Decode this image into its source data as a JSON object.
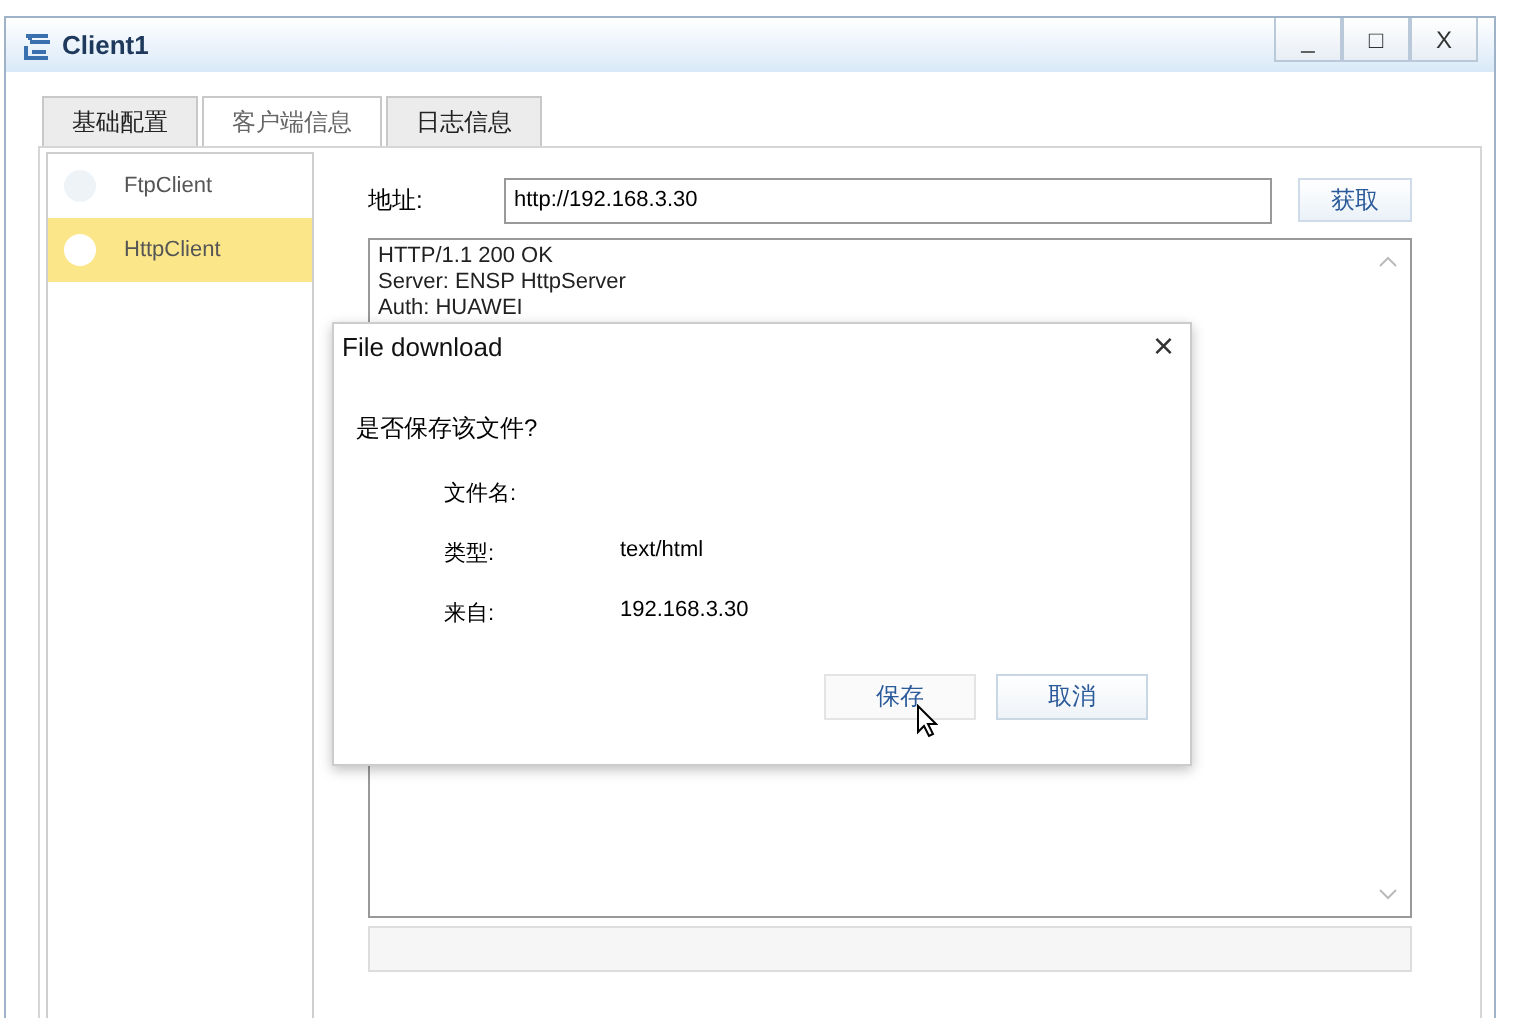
{
  "window": {
    "title": "Client1",
    "controls": [
      "_",
      "□",
      "X"
    ]
  },
  "tabs": [
    {
      "label": "基础配置",
      "selected": false
    },
    {
      "label": "客户端信息",
      "selected": true
    },
    {
      "label": "日志信息",
      "selected": false
    }
  ],
  "sidebar": {
    "items": [
      {
        "label": "FtpClient",
        "selected": false
      },
      {
        "label": "HttpClient",
        "selected": true
      }
    ]
  },
  "address": {
    "label": "地址:",
    "value": "http://192.168.3.30",
    "button": "获取"
  },
  "response": {
    "lines": [
      "HTTP/1.1 200 OK",
      "Server: ENSP HttpServer",
      "Auth: HUAWEI"
    ]
  },
  "dialog": {
    "title": "File download",
    "close": "×",
    "question": "是否保存该文件?",
    "fields": [
      {
        "label": "文件名:"
      },
      {
        "label": "类型:",
        "value": "text/html"
      },
      {
        "label": "来自:",
        "value": "192.168.3.30"
      }
    ],
    "buttons": [
      {
        "label": "保存",
        "selected": true
      },
      {
        "label": "取消",
        "selected": false
      }
    ]
  }
}
